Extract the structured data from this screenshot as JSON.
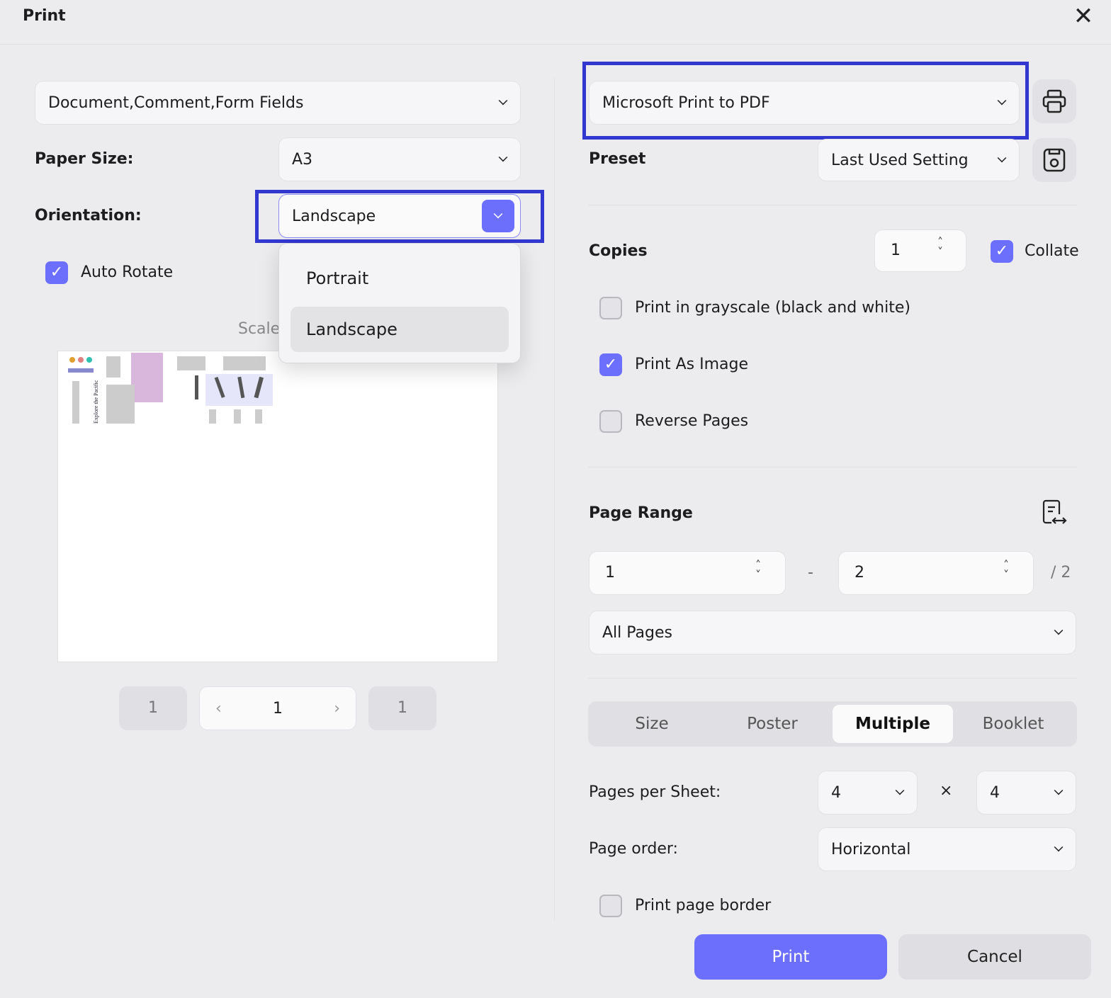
{
  "dialog": {
    "title": "Print"
  },
  "left": {
    "content_select": "Document,Comment,Form Fields",
    "paper_size_label": "Paper Size:",
    "paper_size": "A3",
    "orientation_label": "Orientation:",
    "orientation": "Landscape",
    "orientation_options": [
      "Portrait",
      "Landscape"
    ],
    "auto_rotate_label": "Auto Rotate",
    "auto_rotate": true,
    "scale_label": "Scale:",
    "preview_text": "Explore the Pacific",
    "pager": {
      "first": "1",
      "current": "1",
      "last": "1"
    }
  },
  "right": {
    "printer": "Microsoft Print to PDF",
    "preset_label": "Preset",
    "preset": "Last Used Setting",
    "copies_label": "Copies",
    "copies": "1",
    "collate_label": "Collate",
    "collate": true,
    "grayscale_label": "Print in grayscale (black and white)",
    "grayscale": false,
    "as_image_label": "Print As Image",
    "as_image": true,
    "reverse_label": "Reverse Pages",
    "reverse": false,
    "page_range_label": "Page Range",
    "range_from": "1",
    "range_dash": "-",
    "range_to": "2",
    "range_total": "/ 2",
    "pages_select": "All Pages",
    "tabs": [
      "Size",
      "Poster",
      "Multiple",
      "Booklet"
    ],
    "active_tab": "Multiple",
    "pps_label": "Pages per Sheet:",
    "pps_x": "4",
    "times": "×",
    "pps_y": "4",
    "order_label": "Page order:",
    "order": "Horizontal",
    "border_label": "Print page border",
    "border": false
  },
  "footer": {
    "print": "Print",
    "cancel": "Cancel"
  },
  "colors": {
    "accent": "#6c6ffb",
    "highlight": "#3237d0"
  }
}
